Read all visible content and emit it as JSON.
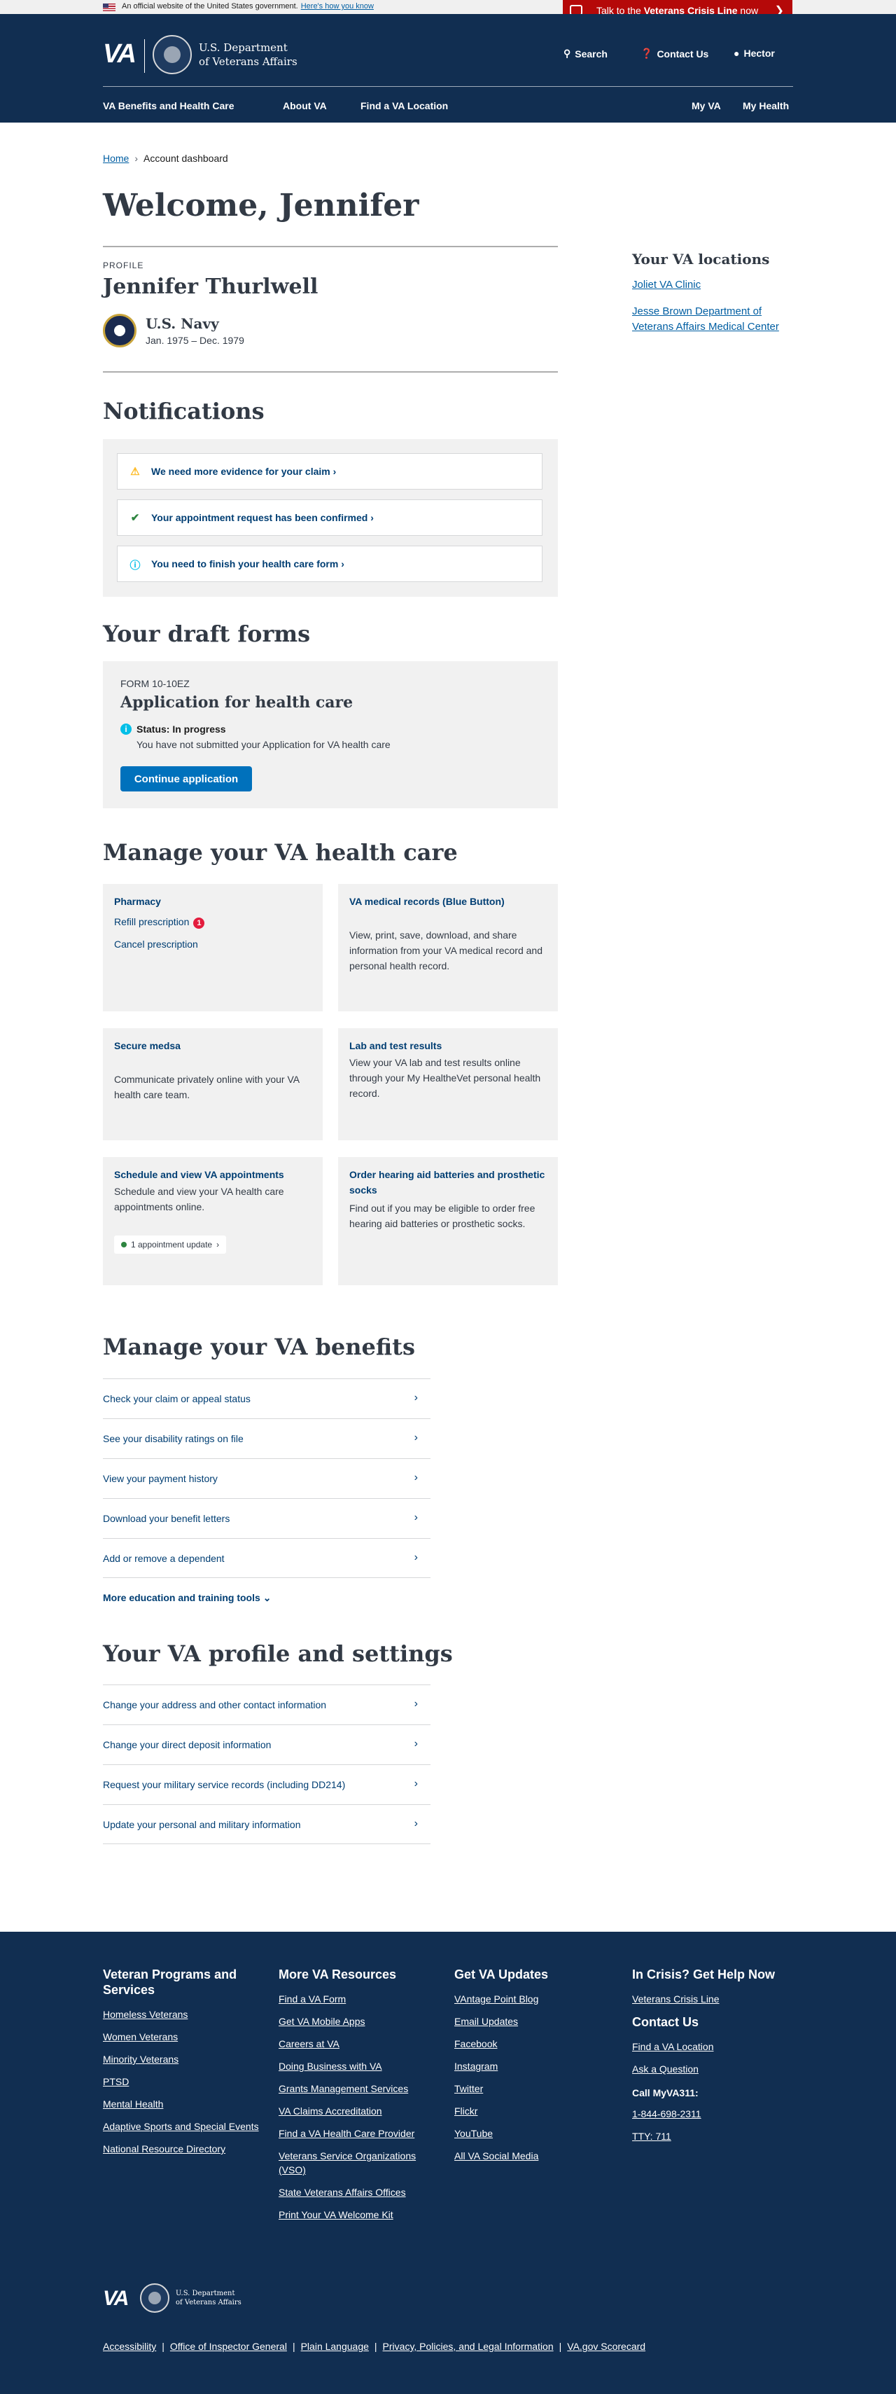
{
  "banner": {
    "official_text": "An official website of the United States government.",
    "how_link": "Here's how you know",
    "crisis_pre": "Talk to the ",
    "crisis_strong": "Veterans Crisis Line",
    "crisis_post": " now"
  },
  "header": {
    "logo": "VA",
    "dept_line1": "U.S. Department",
    "dept_line2": "of Veterans Affairs",
    "search": "Search",
    "contact": "Contact Us",
    "user": "Hector"
  },
  "nav": {
    "benefits": "VA Benefits and Health Care",
    "about": "About VA",
    "find": "Find a VA Location",
    "myva": "My VA",
    "myhealth": "My Health"
  },
  "breadcrumb": {
    "home": "Home",
    "current": "Account dashboard"
  },
  "page_title": "Welcome, Jennifer",
  "profile": {
    "label": "PROFILE",
    "name": "Jennifer Thurlwell",
    "branch": "U.S. Navy",
    "dates": "Jan. 1975 – Dec. 1979"
  },
  "locations": {
    "title": "Your VA locations",
    "items": [
      "Joliet VA Clinic",
      "Jesse Brown Department of Veterans Affairs Medical Center"
    ]
  },
  "notifications": {
    "title": "Notifications",
    "items": [
      "We need more evidence for your claim",
      "Your appointment request has been confirmed",
      "You need to finish your health care form"
    ]
  },
  "drafts": {
    "title": "Your draft forms",
    "form_number": "FORM 10-10EZ",
    "form_title": "Application for health care",
    "status": "Status: In progress",
    "status_detail": "You have not submitted your Application for VA health care",
    "button": "Continue application"
  },
  "health": {
    "title": "Manage your VA health care",
    "pharmacy": {
      "title": "Pharmacy",
      "refill": "Refill prescription",
      "refill_count": "1",
      "cancel": "Cancel prescription"
    },
    "records": {
      "title": "VA medical records (Blue Button)",
      "desc": "View, print, save, download, and share information from your VA medical record and personal health record."
    },
    "messages": {
      "title": "Secure medsa",
      "desc": "Communicate privately online with your VA health care team."
    },
    "labs": {
      "title": "Lab and test results",
      "desc": "View your VA lab and test results online through your My HealtheVet personal health record."
    },
    "appointments": {
      "title": "Schedule and view VA appointments",
      "desc": "Schedule and view your VA health care appointments online.",
      "update": "1 appointment update"
    },
    "hearing": {
      "title": "Order hearing aid batteries and prosthetic socks",
      "desc": "Find out if you may be eligible to order free hearing aid batteries or prosthetic socks."
    }
  },
  "benefits": {
    "title": "Manage your VA benefits",
    "items": [
      "Check your claim or appeal status",
      "See your disability ratings on file",
      "View your payment history",
      "Download your benefit letters",
      "Add or remove a dependent"
    ],
    "more": "More education and training tools"
  },
  "settings": {
    "title": "Your VA profile and settings",
    "items": [
      "Change your address and other contact information",
      "Change your direct deposit information",
      "Request your military service records (including DD214)",
      "Update your personal and military information"
    ]
  },
  "footer": {
    "col1": {
      "title": "Veteran Programs and Services",
      "links": [
        "Homeless Veterans",
        "Women Veterans",
        "Minority Veterans",
        "PTSD",
        "Mental Health",
        "Adaptive Sports and Special Events",
        "National Resource Directory"
      ]
    },
    "col2": {
      "title": "More VA Resources",
      "links": [
        "Find a VA Form",
        "Get VA Mobile Apps",
        "Careers at VA",
        "Doing Business with VA",
        "Grants Management Services",
        "VA Claims Accreditation",
        "Find a VA Health Care Provider",
        "Veterans Service Organizations (VSO)",
        "State Veterans Affairs Offices",
        "Print Your VA Welcome Kit"
      ]
    },
    "col3": {
      "title": "Get VA Updates",
      "links": [
        "VAntage Point Blog",
        "Email Updates",
        "Facebook",
        "Instagram",
        "Twitter",
        "Flickr",
        "YouTube",
        "All VA Social Media"
      ]
    },
    "col4": {
      "crisis_title": "In Crisis? Get Help Now",
      "crisis_link": "Veterans Crisis Line",
      "contact_title": "Contact Us",
      "find_location": "Find a VA Location",
      "ask": "Ask a Question",
      "call_label": "Call MyVA311:",
      "phone": "1-844-698-2311",
      "tty": "TTY: 711"
    },
    "logo": "VA",
    "dept_line1": "U.S. Department",
    "dept_line2": "of Veterans Affairs",
    "legal": [
      "Accessibility",
      "Office of Inspector General",
      "Plain Language",
      "Privacy, Policies, and Legal Information",
      "VA.gov Scorecard"
    ]
  }
}
